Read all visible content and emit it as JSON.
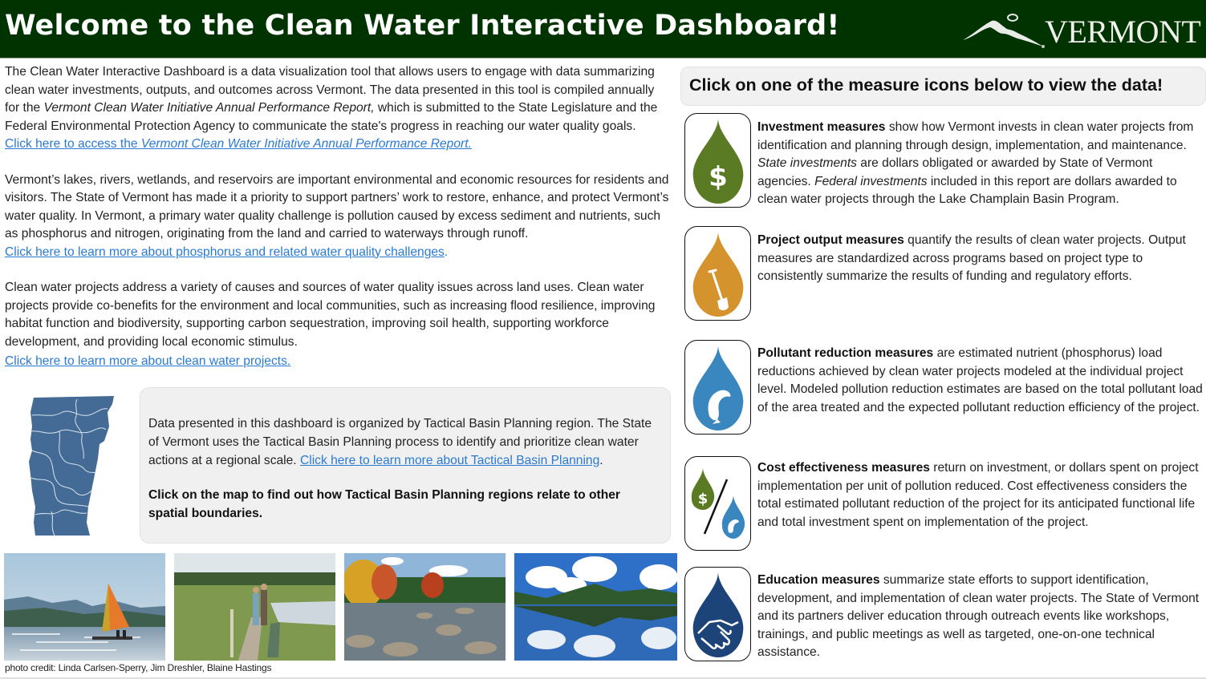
{
  "header": {
    "title": "Welcome to the Clean Water Interactive Dashboard!",
    "logo_text": "VERMONT",
    "colors": {
      "background": "#003300",
      "text": "#ffffff"
    }
  },
  "intro": {
    "p1_a": "The Clean Water Interactive Dashboard is a data visualization tool that allows users to engage with data summarizing clean water investments, outputs, and outcomes across Vermont. The data presented in this tool is compiled annually for the ",
    "p1_em": "Vermont Clean Water Initiative Annual Performance Report,",
    "p1_b": " which is submitted to the State Legislature and the Federal Environmental Protection Agency to communicate the state's progress in reaching our water quality goals.",
    "link1_a": "Click here to access the ",
    "link1_em": "Vermont Clean Water Initiative Annual Performance Report.",
    "p2": "Vermont’s lakes, rivers, wetlands, and reservoirs are important environmental and economic resources for residents and visitors. The State of Vermont has made it a priority to support partners’ work to restore, enhance, and protect Vermont’s water quality. In Vermont, a primary water quality challenge is pollution caused by excess sediment and nutrients, such as phosphorus and nitrogen, originating from the land and carried to waterways through runoff.",
    "link2": "Click here to learn more about phosphorus and related water quality challenges",
    "link2_tail": ".",
    "p3": "Clean water projects address a variety of causes and sources of water quality issues across land uses. Clean water projects provide co-benefits for the environment and local communities, such as increasing flood resilience, improving habitat function and biodiversity, supporting carbon sequestration, improving soil health, supporting workforce development, and providing local economic stimulus.",
    "link3": "Click here to learn more about clean water projects."
  },
  "basin": {
    "map_icon": "vermont-basin-map",
    "text": "Data presented in this dashboard is organized by Tactical Basin Planning region. The State of Vermont uses the Tactical Basin Planning process to identify and prioritize clean water actions at a regional scale. ",
    "link": "Click here to learn more about Tactical Basin Planning",
    "link_tail": ".",
    "bold": "Click on the map to find out how Tactical Basin Planning regions relate to other spatial boundaries."
  },
  "photos": {
    "items": [
      {
        "name": "sailboat-lake-photo"
      },
      {
        "name": "wetland-boardwalk-photo"
      },
      {
        "name": "autumn-river-photo"
      },
      {
        "name": "mountain-lake-reflection-photo"
      }
    ],
    "credit": "photo credit: Linda Carlsen-Sperry, Jim Dreshler, Blaine Hastings"
  },
  "measures_heading": "Click on one of the measure icons below to view the data!",
  "measures": [
    {
      "icon": "dollar-drop-icon",
      "color": "#5a7a23",
      "title": "Investment measures",
      "text_a": " show how Vermont invests in clean water projects from identification and planning through design, implementation, and maintenance. ",
      "em1": "State investments",
      "text_b": " are dollars obligated or awarded by State of Vermont agencies. ",
      "em2": "Federal investments",
      "text_c": " included in this report are dollars awarded to clean water projects through the Lake Champlain Basin Program."
    },
    {
      "icon": "shovel-drop-icon",
      "color": "#d4932c",
      "title": "Project output measures",
      "text": " quantify the results of clean water projects. Output measures are standardized across programs based on project type to consistently summarize the results of funding and regulatory efforts."
    },
    {
      "icon": "fish-drop-icon",
      "color": "#3a87c0",
      "title": "Pollutant reduction measures",
      "text": " are estimated nutrient (phosphorus) load reductions achieved by clean water projects modeled at the individual project level. Modeled pollution reduction estimates are based on the total pollutant load of the area treated and the expected pollutant reduction efficiency of the project."
    },
    {
      "icon": "cost-effectiveness-icon",
      "color": "#5a7a23",
      "title": "Cost effectiveness measures",
      "text": " return on investment, or dollars spent on project implementation per unit of pollution reduced. Cost effectiveness considers the total estimated pollutant reduction of the project for its anticipated functional life and total investment spent on implementation of the project."
    },
    {
      "icon": "handshake-drop-icon",
      "color": "#1d4478",
      "title": "Education measures",
      "text": " summarize state efforts to support identification, development, and implementation of clean water projects. The State of Vermont and its partners deliver education through outreach events like workshops, trainings, and public meetings as well as targeted, one-on-one technical assistance."
    }
  ]
}
